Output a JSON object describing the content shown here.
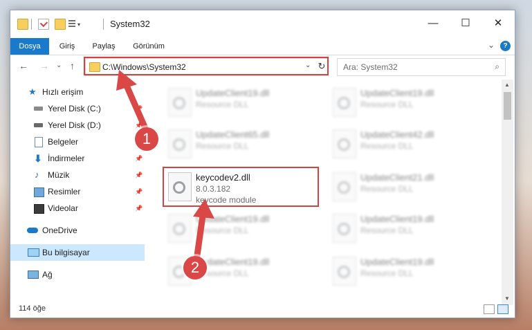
{
  "window": {
    "title": "System32",
    "controls": {
      "minimize": "—",
      "maximize": "☐",
      "close": "✕"
    }
  },
  "ribbon": {
    "tabs": [
      "Dosya",
      "Giriş",
      "Paylaş",
      "Görünüm"
    ],
    "expand_glyph": "⌄",
    "help_glyph": "?"
  },
  "nav": {
    "back": "←",
    "forward": "→",
    "recent": "⌄",
    "up": "↑"
  },
  "address": {
    "path": "C:\\Windows\\System32",
    "refresh": "↻",
    "chevron": "⌄"
  },
  "search": {
    "placeholder": "Ara: System32",
    "icon": "⌕"
  },
  "sidebar": {
    "items": [
      {
        "label": "Hızlı erişim",
        "icon": "star-icon"
      },
      {
        "label": "Yerel Disk (C:)",
        "icon": "drive-icon",
        "pinned": true
      },
      {
        "label": "Yerel Disk (D:)",
        "icon": "drive-icon",
        "pinned": true
      },
      {
        "label": "Belgeler",
        "icon": "document-icon",
        "pinned": true
      },
      {
        "label": "İndirmeler",
        "icon": "download-icon",
        "pinned": true
      },
      {
        "label": "Müzik",
        "icon": "music-icon",
        "pinned": true
      },
      {
        "label": "Resimler",
        "icon": "pictures-icon",
        "pinned": true
      },
      {
        "label": "Videolar",
        "icon": "video-icon",
        "pinned": true
      },
      {
        "label": "OneDrive",
        "icon": "cloud-icon"
      },
      {
        "label": "Bu bilgisayar",
        "icon": "computer-icon",
        "selected": true
      },
      {
        "label": "Ağ",
        "icon": "network-icon"
      }
    ],
    "pin_glyph": "📌"
  },
  "files": {
    "left": [
      {
        "name": "UpdateClient19.dll",
        "type": "Resource DLL"
      },
      {
        "name": "UpdateClient65.dll",
        "type": "Resource DLL"
      },
      {
        "name": "keycodev2.dll",
        "version": "8.0.3.182",
        "description": "keycode module"
      },
      {
        "name": "UpdateClient19.dll",
        "type": "Resource DLL"
      },
      {
        "name": "UpdateClient19.dll",
        "type": "Resource DLL"
      }
    ],
    "right": [
      {
        "name": "UpdateClient19.dll",
        "type": "Resource DLL"
      },
      {
        "name": "UpdateClient42.dll",
        "type": "Resource DLL"
      },
      {
        "name": "UpdateClient21.dll",
        "type": "Resource DLL"
      },
      {
        "name": "UpdateClient19.dll",
        "type": "Resource DLL"
      },
      {
        "name": "UpdateClient19.dll",
        "type": "Resource DLL"
      }
    ]
  },
  "status": {
    "item_count": "114 öğe"
  },
  "callouts": [
    "1",
    "2"
  ],
  "colors": {
    "accent": "#1979ca",
    "highlight": "#d6403f",
    "selection": "#cce8ff"
  }
}
